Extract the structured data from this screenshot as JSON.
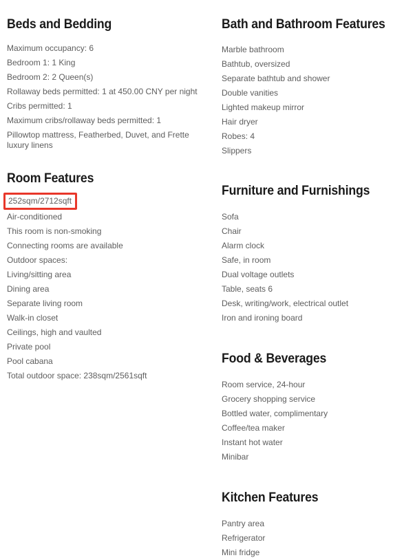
{
  "accent": {
    "highlight_border": "#e8372a",
    "heading_color": "#1a1a1a",
    "body_color": "#5d5d5d",
    "background": "#ffffff"
  },
  "left_column": {
    "sections": [
      {
        "heading": "Beds and Bedding",
        "items": [
          "Maximum occupancy: 6",
          "Bedroom 1: 1 King",
          "Bedroom 2: 2 Queen(s)",
          "Rollaway beds permitted: 1 at 450.00 CNY per night",
          "Cribs permitted: 1",
          "Maximum cribs/rollaway beds permitted: 1",
          "Pillowtop mattress, Featherbed, Duvet, and Frette luxury linens"
        ]
      },
      {
        "heading": "Room Features",
        "items": [
          "252sqm/2712sqft",
          "Air-conditioned",
          "This room is non-smoking",
          "Connecting rooms are available",
          "Outdoor spaces:",
          "Living/sitting area",
          "Dining area",
          "Separate living room",
          "Walk-in closet",
          "Ceilings, high and vaulted",
          "Private pool",
          "Pool cabana",
          "Total outdoor space: 238sqm/2561sqft"
        ]
      }
    ]
  },
  "right_column": {
    "sections": [
      {
        "heading": "Bath and Bathroom Features",
        "items": [
          "Marble bathroom",
          "Bathtub, oversized",
          "Separate bathtub and shower",
          "Double vanities",
          "Lighted makeup mirror",
          "Hair dryer",
          "Robes: 4",
          "Slippers"
        ]
      },
      {
        "heading": "Furniture and Furnishings",
        "items": [
          "Sofa",
          "Chair",
          "Alarm clock",
          "Safe, in room",
          "Dual voltage outlets",
          "Table, seats 6",
          "Desk, writing/work, electrical outlet",
          "Iron and ironing board"
        ]
      },
      {
        "heading": "Food & Beverages",
        "items": [
          "Room service, 24-hour",
          "Grocery shopping service",
          "Bottled water, complimentary",
          "Coffee/tea maker",
          "Instant hot water",
          "Minibar"
        ]
      },
      {
        "heading": "Kitchen Features",
        "items": [
          "Pantry area",
          "Refrigerator",
          "Mini fridge"
        ]
      }
    ]
  }
}
